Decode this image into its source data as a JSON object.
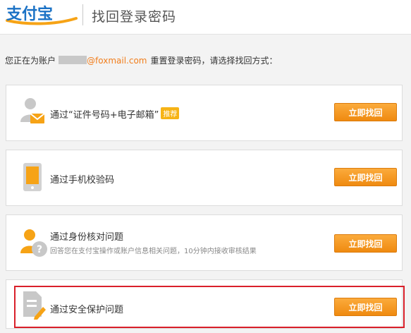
{
  "header": {
    "logo_text": "支付宝",
    "title": "找回登录密码"
  },
  "intro": {
    "prefix": "您正在为账户",
    "email_suffix": "@foxmail.com",
    "suffix": "重置登录密码，请选择找回方式："
  },
  "options": [
    {
      "label": "通过“证件号码+电子邮箱”",
      "badge": "推荐",
      "button": "立即找回",
      "icon": "id-email-icon"
    },
    {
      "label": "通过手机校验码",
      "button": "立即找回",
      "icon": "mobile-phone-icon"
    },
    {
      "label": "通过身份核对问题",
      "sublabel": "回答您在支付宝操作或账户信息相关问题，10分钟内接收审核结果",
      "button": "立即找回",
      "icon": "identity-question-icon"
    },
    {
      "label": "通过安全保护问题",
      "button": "立即找回",
      "icon": "security-question-icon"
    }
  ],
  "colors": {
    "accent": "#f08f17",
    "email": "#f17e1c",
    "highlight": "#d9202a",
    "icon_gray": "#c8c8c8"
  }
}
